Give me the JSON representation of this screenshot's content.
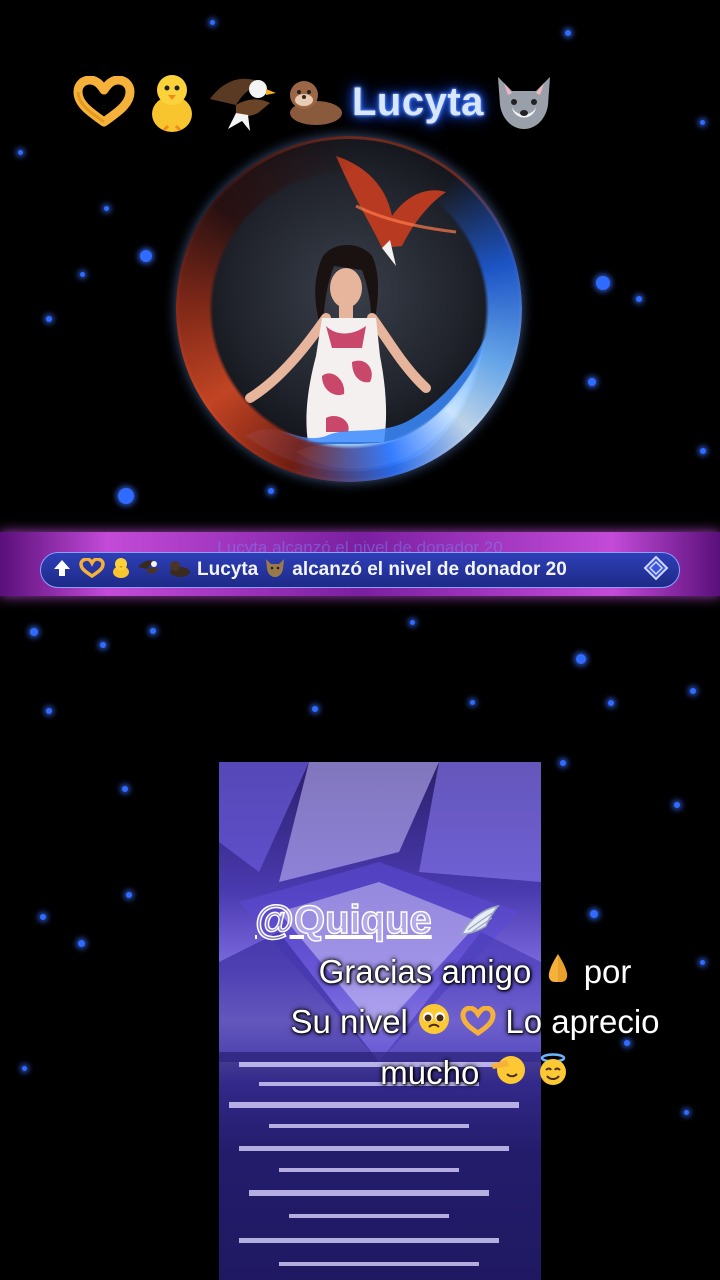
{
  "header": {
    "username": "Lucyta",
    "emoji_icons": [
      "heart-hands-icon",
      "chick-icon",
      "eagle-icon",
      "otter-icon"
    ],
    "trailing_icon": "wolf-icon"
  },
  "banner": {
    "up_icon": "up-arrow-icon",
    "ghost_text": "Lucyta alcanzó el nivel de donador 20",
    "username": "Lucyta",
    "message": "alcanzó el nivel de donador 20",
    "badge_icon": "diamond-icon"
  },
  "message": {
    "handle": "@Quique",
    "line1_a": "Gracias  amigo",
    "line1_b": "por",
    "line2_a": "Su nivel",
    "line2_b": "Lo aprecio",
    "line3": "mucho"
  },
  "colors": {
    "accent_blue": "#2f6bff",
    "banner_purple": "#c34bd8",
    "pill_blue": "#2e3fb8"
  }
}
